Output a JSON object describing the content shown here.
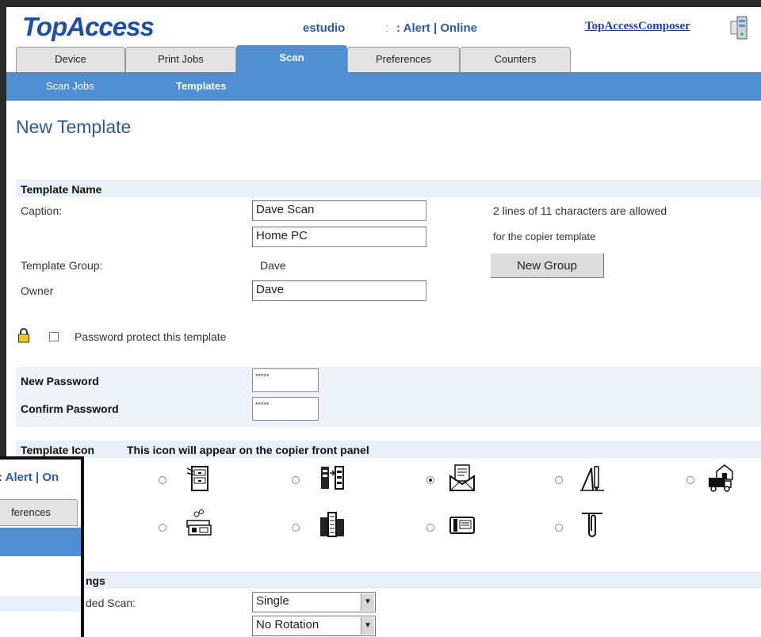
{
  "header": {
    "logo": "TopAccess",
    "device_name": "estudio",
    "status_sep": ":",
    "status": ": Alert | Online",
    "composer_link": "TopAccessComposer"
  },
  "tabs": [
    {
      "label": "Device"
    },
    {
      "label": "Print Jobs"
    },
    {
      "label": "Scan",
      "active": true
    },
    {
      "label": "Preferences"
    },
    {
      "label": "Counters"
    }
  ],
  "subnav": [
    {
      "label": "Scan Jobs"
    },
    {
      "label": "Templates",
      "active": true
    }
  ],
  "page_title": "New Template",
  "template_name": {
    "section": "Template Name",
    "caption_label": "Caption:",
    "caption_line1": "Dave Scan",
    "caption_line2": "Home PC",
    "hint1": "2 lines of 11 characters are allowed",
    "hint2": "for the copier template",
    "group_label": "Template Group:",
    "group_value": "Dave",
    "new_group_button": "New Group",
    "owner_label": "Owner",
    "owner_value": "Dave"
  },
  "password": {
    "protect_label": "Password protect this template",
    "protect_checked": false,
    "new_label": "New Password",
    "new_value": "*****",
    "confirm_label": "Confirm Password",
    "confirm_value": "*****"
  },
  "template_icon": {
    "section": "Template Icon",
    "note": "This icon will appear on the copier front panel",
    "icons": [
      {
        "name": "file-cabinet-icon",
        "selected": false
      },
      {
        "name": "server-transfer-icon",
        "selected": false
      },
      {
        "name": "mail-envelope-icon",
        "selected": true
      },
      {
        "name": "drafting-tools-icon",
        "selected": false
      },
      {
        "name": "house-truck-icon",
        "selected": false
      },
      {
        "name": "money-icon",
        "selected": false
      },
      {
        "name": "buildings-icon",
        "selected": false
      },
      {
        "name": "fax-machine-icon",
        "selected": false
      },
      {
        "name": "paperclip-icon",
        "selected": false
      }
    ]
  },
  "scan_settings": {
    "section_partial": "ngs",
    "sided_label_partial": "ded Scan:",
    "sided_value": "Single",
    "rotation_value": "No Rotation"
  },
  "background_window": {
    "status": ": Alert | On",
    "tab": "ferences"
  }
}
